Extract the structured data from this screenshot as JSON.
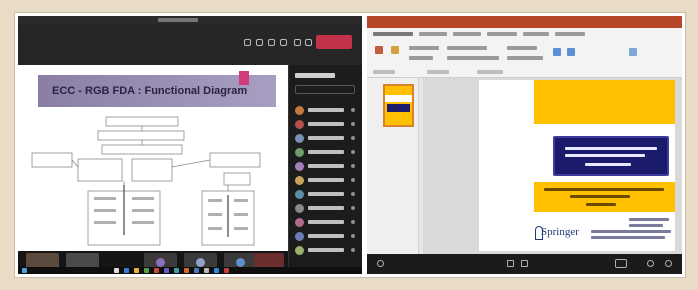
{
  "meeting": {
    "leave_label": "",
    "slide_title": "ECC - RGB FDA : Functional Diagram"
  },
  "presentation": {
    "publisher_label": "Springer"
  },
  "colors": {
    "leave_red": "#c4314b",
    "slide_gold": "#ffc000",
    "slide_navy": "#1b1b6b",
    "ppt_orange": "#b7472a",
    "springer_blue": "#1e3a78"
  }
}
